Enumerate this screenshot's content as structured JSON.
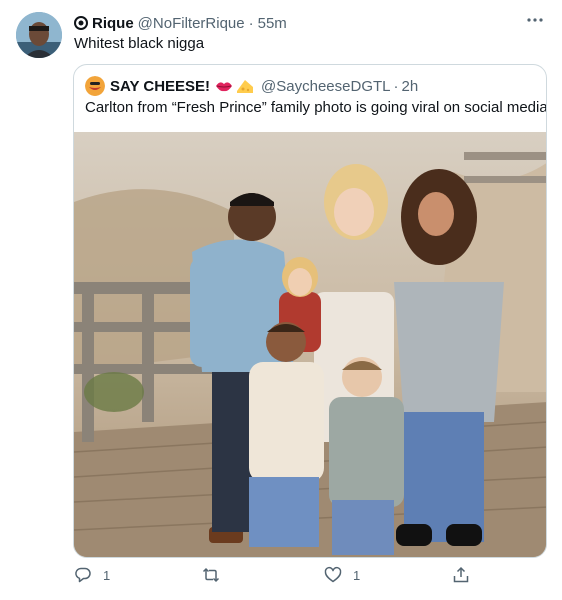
{
  "tweet": {
    "author_name": "Rique",
    "handle": "@NoFilterRique",
    "separator": "·",
    "time": "55m",
    "text": "Whitest black nigga"
  },
  "quote": {
    "author_name": "SAY CHEESE!",
    "handle": "@SaycheeseDGTL",
    "separator": "·",
    "time": "2h",
    "text": "Carlton from “Fresh Prince” family photo is going viral on social media"
  },
  "actions": {
    "reply_count": "1",
    "like_count": "1"
  },
  "colors": {
    "text": "#0f1419",
    "secondary": "#536471",
    "border": "#cfd9de"
  }
}
